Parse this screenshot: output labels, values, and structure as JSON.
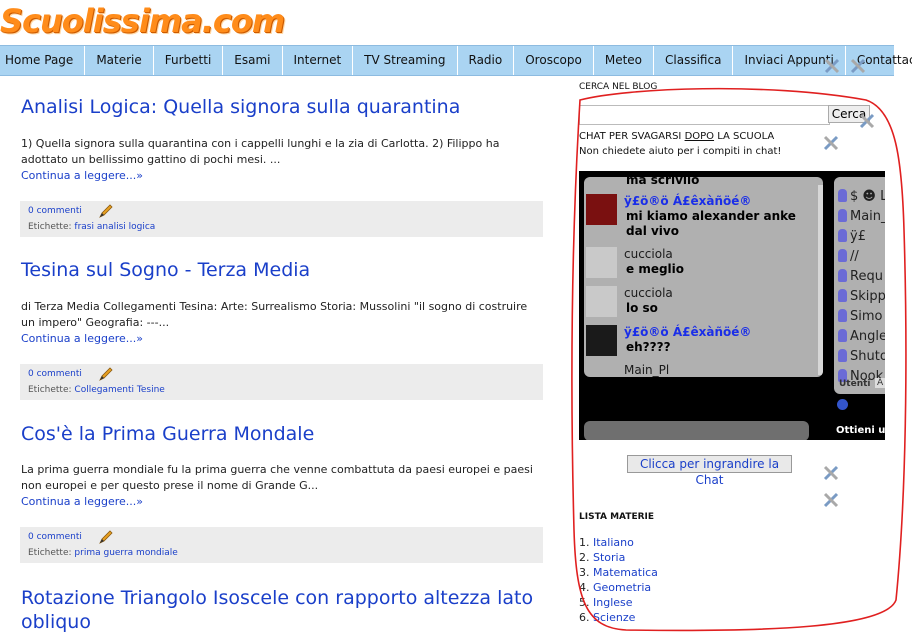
{
  "site": {
    "logo": "Scuolissima.com"
  },
  "nav": [
    "Home Page",
    "Materie",
    "Furbetti",
    "Esami",
    "Internet",
    "TV Streaming",
    "Radio",
    "Oroscopo",
    "Meteo",
    "Classifica",
    "Inviaci Appunti",
    "Contattaci"
  ],
  "posts": [
    {
      "title": "Analisi Logica: Quella signora sulla quarantina",
      "excerpt": "1) Quella signora sulla quarantina con i cappelli lunghi e la zia di Carlotta. 2) Filippo ha adottato un bellissimo gattino di pochi mesi. ...",
      "more": "Continua a leggere...»",
      "comments": "0 commenti",
      "labels_prefix": "Etichette:",
      "labels": "frasi analisi logica"
    },
    {
      "title": "Tesina sul Sogno - Terza Media",
      "excerpt": "di Terza Media Collegamenti Tesina: Arte: Surrealismo Storia: Mussolini \"il sogno di costruire un impero\" Geografia: ---...",
      "more": "Continua a leggere...»",
      "comments": "0 commenti",
      "labels_prefix": "Etichette:",
      "labels": "Collegamenti Tesine"
    },
    {
      "title": "Cos'è la Prima Guerra Mondale",
      "excerpt": "La prima guerra mondiale fu la prima guerra che venne combattuta da paesi europei e paesi non europei e per questo prese il nome di Grande G...",
      "more": "Continua a leggere...»",
      "comments": "0 commenti",
      "labels_prefix": "Etichette:",
      "labels": "prima guerra mondiale"
    },
    {
      "title": "Rotazione Triangolo Isoscele con rapporto altezza lato obliquo"
    }
  ],
  "sidebar": {
    "search_heading": "CERCA NEL BLOG",
    "search_button": "Cerca",
    "chat_heading_pre": "CHAT PER SVAGARSI ",
    "chat_heading_dopo": "DOPO",
    "chat_heading_post": " LA SCUOLA",
    "chat_note": "Non chiedete aiuto per i compiti in chat!",
    "chat_button": "Clicca per ingrandire la Chat",
    "list_heading": "LISTA MATERIE",
    "materie": [
      {
        "n": "1.",
        "name": "Italiano"
      },
      {
        "n": "2.",
        "name": "Storia"
      },
      {
        "n": "3.",
        "name": "Matematica"
      },
      {
        "n": "4.",
        "name": "Geometria"
      },
      {
        "n": "5.",
        "name": "Inglese"
      },
      {
        "n": "6.",
        "name": "Scienze"
      }
    ]
  },
  "chat": {
    "messages": [
      {
        "nick": "",
        "text": "ma scrivilo"
      },
      {
        "nick": "ÿ£ö®ö Á£êxàñöé®",
        "text": "mi kiamo alexander anke",
        "text2": "dal vivo"
      },
      {
        "nick": "cucciola",
        "text": "e meglio"
      },
      {
        "nick": "cucciola",
        "text": "lo so"
      },
      {
        "nick": "ÿ£ö®ö Á£êxàñöé®",
        "text": "eh????"
      },
      {
        "nick": "Main_Pl",
        "text": ""
      }
    ],
    "users": [
      "$ ☻ L",
      "Main_",
      "ÿ£",
      "//",
      "Requ",
      "Skipp",
      "Simo",
      "Angle",
      "Shuto",
      "Nook"
    ],
    "tab_users": "Utenti",
    "tab_other": "A",
    "get_label": "Ottieni una"
  },
  "colors": {
    "nav_bg": "#aad4f2",
    "link": "#1a3fc9",
    "logo": "#ff8c1a",
    "annotation": "#e02020"
  }
}
